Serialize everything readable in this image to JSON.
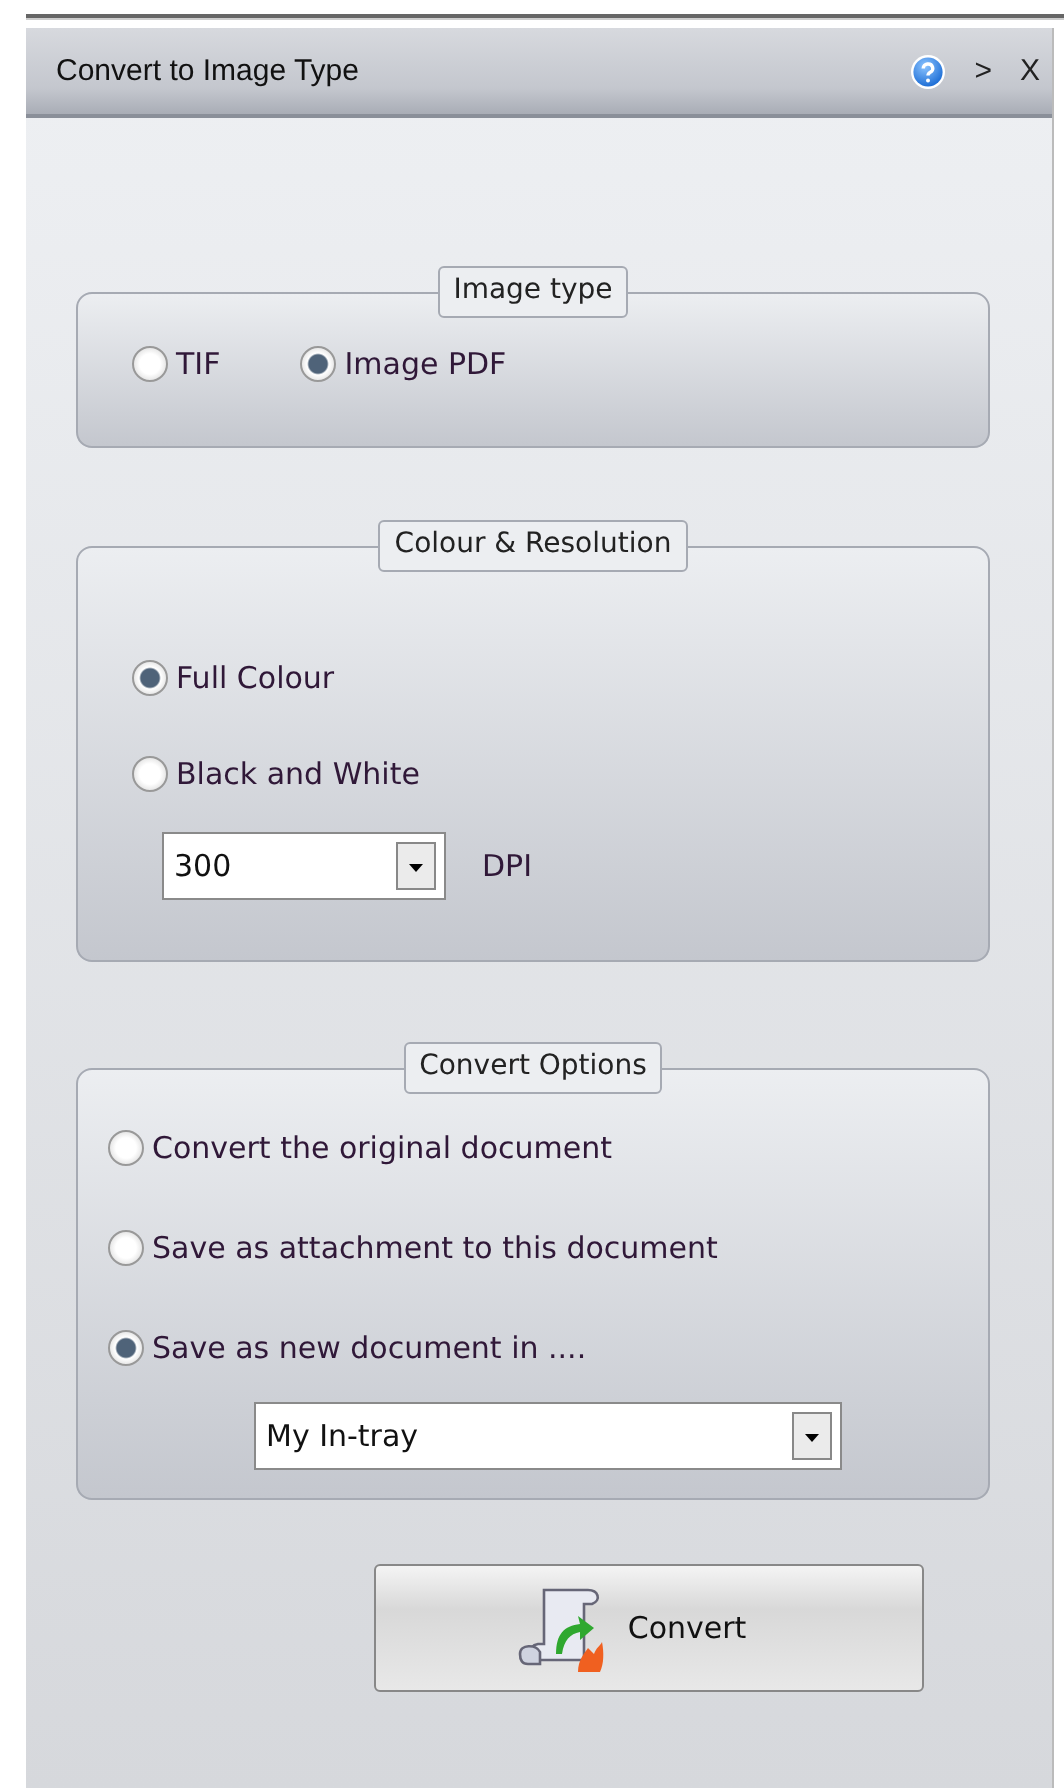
{
  "window": {
    "title": "Convert to Image Type",
    "controls": [
      {
        "kind": "help"
      },
      {
        "kind": "text",
        "label": ">"
      },
      {
        "kind": "text",
        "label": "X"
      }
    ]
  },
  "sections": [
    {
      "legend": "Image type",
      "kind": "inline",
      "items": [
        {
          "kind": "radio",
          "label": "TIF",
          "selected": false
        },
        {
          "kind": "radio",
          "label": "Image PDF",
          "selected": true
        }
      ]
    },
    {
      "legend": "Colour & Resolution",
      "kind": "stacked",
      "items": [
        {
          "kind": "radio",
          "label": "Full Colour",
          "selected": true
        },
        {
          "kind": "radio",
          "label": "Black and White",
          "selected": false
        },
        {
          "kind": "dropdown",
          "value": "300",
          "unit": "DPI"
        }
      ]
    },
    {
      "legend": "Convert Options",
      "kind": "stacked",
      "items": [
        {
          "kind": "radio",
          "label": "Convert the original document",
          "selected": false
        },
        {
          "kind": "radio",
          "label": "Save as attachment to this document",
          "selected": false
        },
        {
          "kind": "radio",
          "label": "Save as new document in ....",
          "selected": true
        },
        {
          "kind": "dropdown",
          "value": "My In-tray"
        }
      ]
    }
  ],
  "button": {
    "label": "Convert"
  }
}
